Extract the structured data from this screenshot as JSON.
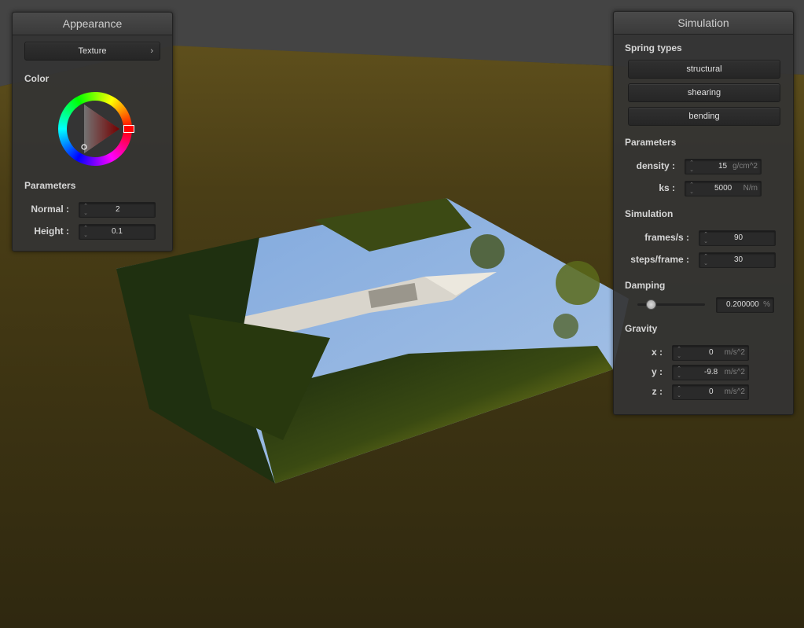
{
  "appearance": {
    "title": "Appearance",
    "texture_button": "Texture",
    "color_label": "Color",
    "parameters_label": "Parameters",
    "normal_label": "Normal :",
    "normal_value": "2",
    "height_label": "Height :",
    "height_value": "0.1"
  },
  "simulation": {
    "title": "Simulation",
    "spring_types_label": "Spring types",
    "spring_buttons": [
      "structural",
      "shearing",
      "bending"
    ],
    "parameters_label": "Parameters",
    "density_label": "density :",
    "density_value": "15",
    "density_unit": "g/cm^2",
    "ks_label": "ks :",
    "ks_value": "5000",
    "ks_unit": "N/m",
    "simulation_label": "Simulation",
    "fps_label": "frames/s :",
    "fps_value": "90",
    "steps_label": "steps/frame :",
    "steps_value": "30",
    "damping_label": "Damping",
    "damping_value": "0.200000",
    "damping_unit": "%",
    "damping_fraction": 0.2,
    "gravity_label": "Gravity",
    "gx_label": "x :",
    "gx_value": "0",
    "gy_label": "y :",
    "gy_value": "-9.8",
    "gz_label": "z :",
    "gz_value": "0",
    "gravity_unit": "m/s^2"
  }
}
